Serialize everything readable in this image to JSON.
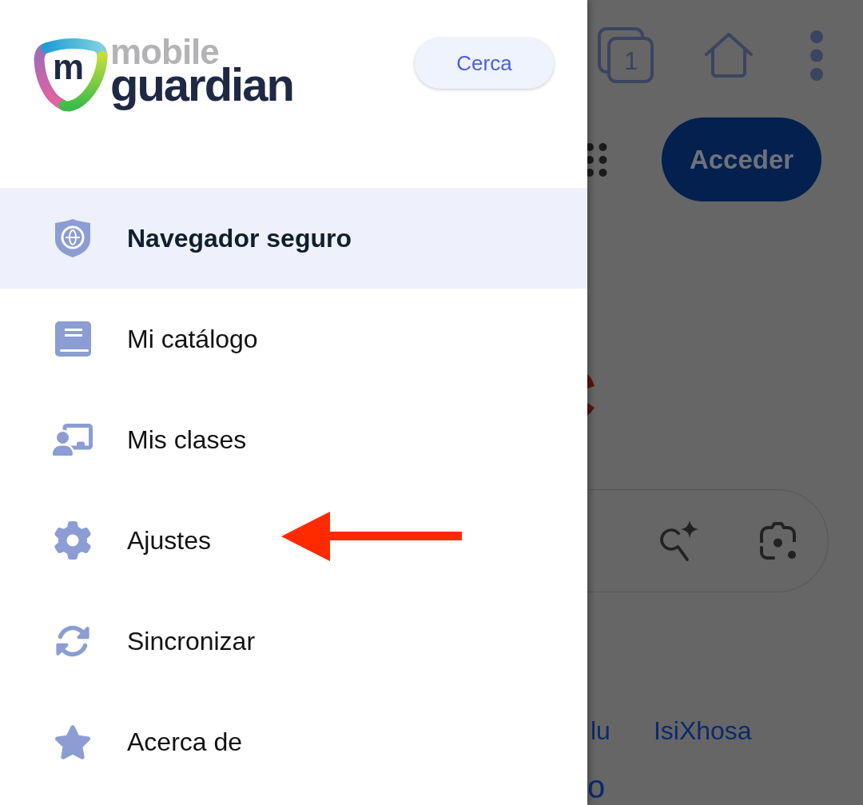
{
  "drawer": {
    "logo": {
      "letter": "m",
      "top_word": "mobile",
      "bottom_word": "guardian"
    },
    "close_button": {
      "label": "Cerca"
    },
    "items": [
      {
        "kind": "browser",
        "label": "Navegador seguro",
        "selected": true,
        "pointer_arrow": false
      },
      {
        "kind": "catalog",
        "label": "Mi catálogo",
        "selected": false,
        "pointer_arrow": false
      },
      {
        "kind": "classes",
        "label": "Mis clases",
        "selected": false,
        "pointer_arrow": false
      },
      {
        "kind": "settings",
        "label": "Ajustes",
        "selected": false,
        "pointer_arrow": true
      },
      {
        "kind": "sync",
        "label": "Sincronizar",
        "selected": false,
        "pointer_arrow": false
      },
      {
        "kind": "about",
        "label": "Acerca de",
        "selected": false,
        "pointer_arrow": false
      }
    ]
  },
  "page_behind": {
    "tab_count": "1",
    "sign_in_button": {
      "label": "Acceder"
    },
    "language_links": [
      {
        "label": "lu"
      },
      {
        "label": "IsiXhosa"
      }
    ],
    "language_links_row_2": [
      {
        "label": "o"
      }
    ]
  }
}
